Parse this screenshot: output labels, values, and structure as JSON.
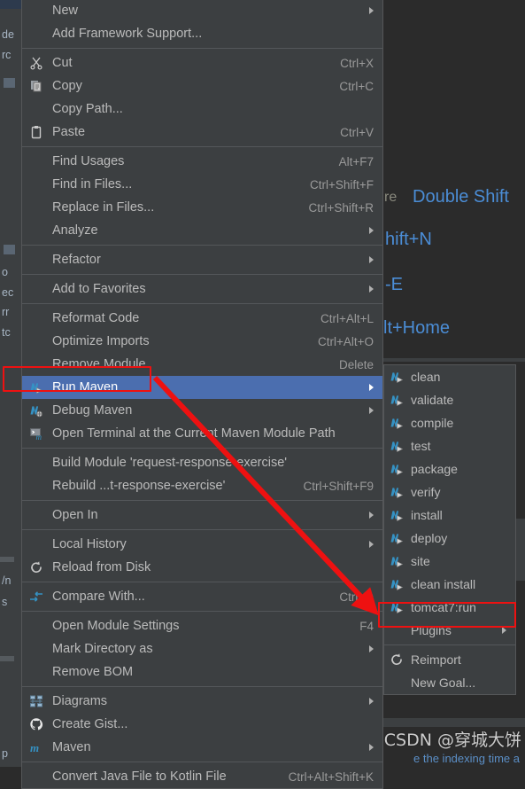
{
  "app": {
    "theme_bg": "#2b2b2b",
    "menu_bg": "#3c3f41",
    "menu_border": "#555759",
    "selection_bg": "#4b6eaf",
    "text_color": "#bbbbbb",
    "accent_blue": "#4b8dd6",
    "annotation_red": "#ee1111"
  },
  "background": {
    "tree_fragments": [
      "de",
      "rc",
      "o",
      "ec",
      "rr",
      "tc",
      "/n",
      "s",
      "p"
    ],
    "tips": [
      {
        "grey": "re",
        "blue": "Double Shift"
      },
      {
        "grey": "",
        "blue": "hift+N"
      },
      {
        "grey": "",
        "blue": "-E"
      },
      {
        "grey": "",
        "blue": "lt+Home"
      }
    ],
    "bottom_hint": "e the indexing time a"
  },
  "context_menu": {
    "name": "module-context-menu",
    "items": [
      {
        "label": "New",
        "accel": "",
        "icon": "",
        "submenu": true,
        "mnemonic": ""
      },
      {
        "label": "Add Framework Support...",
        "accel": "",
        "icon": "",
        "submenu": false
      },
      {
        "sep": true
      },
      {
        "label": "Cut",
        "accel": "Ctrl+X",
        "icon": "scissors-icon",
        "submenu": false
      },
      {
        "label": "Copy",
        "accel": "Ctrl+C",
        "icon": "copy-icon",
        "submenu": false
      },
      {
        "label": "Copy Path...",
        "accel": "",
        "icon": "",
        "submenu": false
      },
      {
        "label": "Paste",
        "accel": "Ctrl+V",
        "icon": "clipboard-icon",
        "submenu": false
      },
      {
        "sep": true
      },
      {
        "label": "Find Usages",
        "accel": "Alt+F7",
        "icon": "",
        "submenu": false
      },
      {
        "label": "Find in Files...",
        "accel": "Ctrl+Shift+F",
        "icon": "",
        "submenu": false
      },
      {
        "label": "Replace in Files...",
        "accel": "Ctrl+Shift+R",
        "icon": "",
        "submenu": false
      },
      {
        "label": "Analyze",
        "accel": "",
        "icon": "",
        "submenu": true
      },
      {
        "sep": true
      },
      {
        "label": "Refactor",
        "accel": "",
        "icon": "",
        "submenu": true
      },
      {
        "sep": true
      },
      {
        "label": "Add to Favorites",
        "accel": "",
        "icon": "",
        "submenu": true
      },
      {
        "sep": true
      },
      {
        "label": "Reformat Code",
        "accel": "Ctrl+Alt+L",
        "icon": "",
        "submenu": false
      },
      {
        "label": "Optimize Imports",
        "accel": "Ctrl+Alt+O",
        "icon": "",
        "submenu": false
      },
      {
        "label": "Remove Module",
        "accel": "Delete",
        "icon": "",
        "submenu": false
      },
      {
        "label": "Run Maven",
        "accel": "",
        "icon": "maven-run-icon",
        "submenu": true,
        "selected": true
      },
      {
        "label": "Debug Maven",
        "accel": "",
        "icon": "maven-debug-icon",
        "submenu": true
      },
      {
        "label": "Open Terminal at the Current Maven Module Path",
        "accel": "",
        "icon": "terminal-maven-icon",
        "submenu": false
      },
      {
        "sep": true
      },
      {
        "label": "Build Module 'request-response-exercise'",
        "accel": "",
        "icon": "",
        "submenu": false
      },
      {
        "label": "Rebuild ...t-response-exercise'",
        "accel": "Ctrl+Shift+F9",
        "icon": "",
        "submenu": false
      },
      {
        "sep": true
      },
      {
        "label": "Open In",
        "accel": "",
        "icon": "",
        "submenu": true
      },
      {
        "sep": true
      },
      {
        "label": "Local History",
        "accel": "",
        "icon": "",
        "submenu": true
      },
      {
        "label": "Reload from Disk",
        "accel": "",
        "icon": "refresh-icon",
        "submenu": false
      },
      {
        "sep": true
      },
      {
        "label": "Compare With...",
        "accel": "Ctrl+D",
        "icon": "compare-icon",
        "submenu": false
      },
      {
        "sep": true
      },
      {
        "label": "Open Module Settings",
        "accel": "F4",
        "icon": "",
        "submenu": false
      },
      {
        "label": "Mark Directory as",
        "accel": "",
        "icon": "",
        "submenu": true
      },
      {
        "label": "Remove BOM",
        "accel": "",
        "icon": "",
        "submenu": false
      },
      {
        "sep": true
      },
      {
        "label": "Diagrams",
        "accel": "",
        "icon": "diagram-icon",
        "submenu": true
      },
      {
        "label": "Create Gist...",
        "accel": "",
        "icon": "github-icon",
        "submenu": false
      },
      {
        "label": "Maven",
        "accel": "",
        "icon": "maven-m-icon",
        "submenu": true
      },
      {
        "sep": true
      },
      {
        "label": "Convert Java File to Kotlin File",
        "accel": "Ctrl+Alt+Shift+K",
        "icon": "",
        "submenu": false
      }
    ]
  },
  "maven_submenu": {
    "name": "run-maven-submenu",
    "items": [
      {
        "label": "clean",
        "icon": "maven-goal-icon",
        "submenu": false
      },
      {
        "label": "validate",
        "icon": "maven-goal-icon",
        "submenu": false
      },
      {
        "label": "compile",
        "icon": "maven-goal-icon",
        "submenu": false
      },
      {
        "label": "test",
        "icon": "maven-goal-icon",
        "submenu": false
      },
      {
        "label": "package",
        "icon": "maven-goal-icon",
        "submenu": false
      },
      {
        "label": "verify",
        "icon": "maven-goal-icon",
        "submenu": false
      },
      {
        "label": "install",
        "icon": "maven-goal-icon",
        "submenu": false
      },
      {
        "label": "deploy",
        "icon": "maven-goal-icon",
        "submenu": false
      },
      {
        "label": "site",
        "icon": "maven-goal-icon",
        "submenu": false
      },
      {
        "label": "clean install",
        "icon": "maven-goal-icon",
        "submenu": false
      },
      {
        "label": "tomcat7:run",
        "icon": "maven-goal-icon",
        "submenu": false,
        "highlighted": true
      },
      {
        "label": "Plugins",
        "icon": "",
        "submenu": true
      },
      {
        "sep": true
      },
      {
        "label": "Reimport",
        "icon": "refresh-icon",
        "submenu": false
      },
      {
        "label": "New Goal...",
        "icon": "",
        "submenu": false
      }
    ]
  },
  "annotations": {
    "run_maven_box": "highlight-run-maven",
    "tomcat_box": "highlight-tomcat7-run",
    "arrow": "red-arrow-run-maven-to-tomcat7"
  },
  "watermark": {
    "text": "CSDN @穿城大饼"
  }
}
